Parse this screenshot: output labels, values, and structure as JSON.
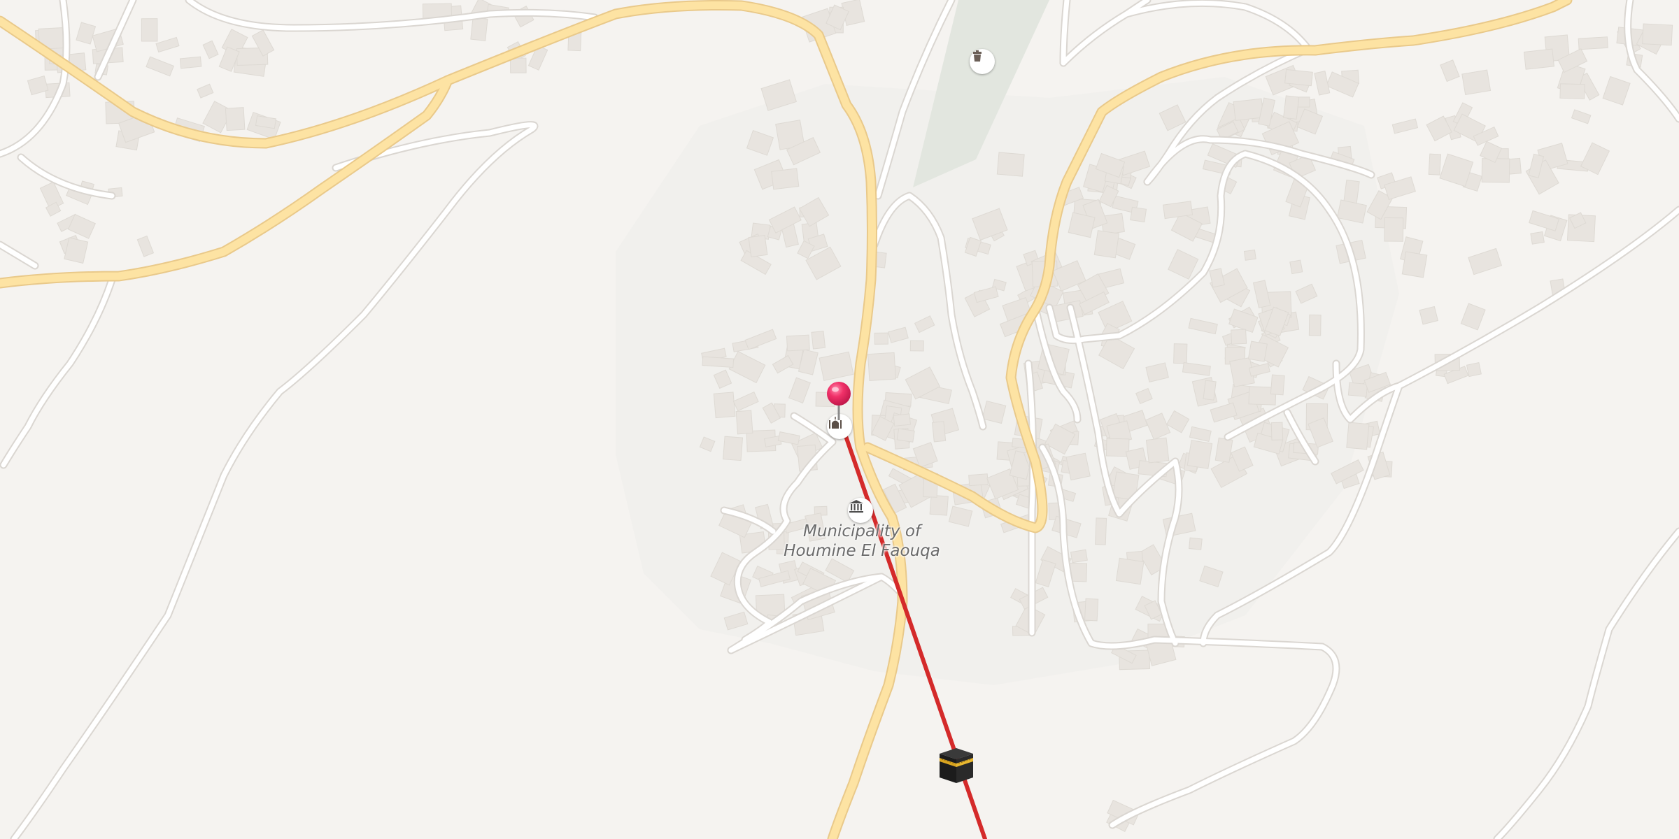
{
  "map": {
    "place_label_line1": "Municipality of",
    "place_label_line2": "Houmine El Faouqa",
    "icons": {
      "location_pin": "red-location-pin-icon",
      "mosque_poi": "mosque-icon",
      "town_hall_poi": "town-hall-icon",
      "cemetery_poi": "cemetery-icon",
      "kaaba": "kaaba-icon"
    },
    "colors": {
      "background": "#f5f3f0",
      "major_road": "#fde3a3",
      "minor_road": "#ffffff",
      "building": "#e8e4df",
      "park": "#e2e6df",
      "qibla_line": "#d42a2a",
      "pin": "#e8265e"
    }
  }
}
